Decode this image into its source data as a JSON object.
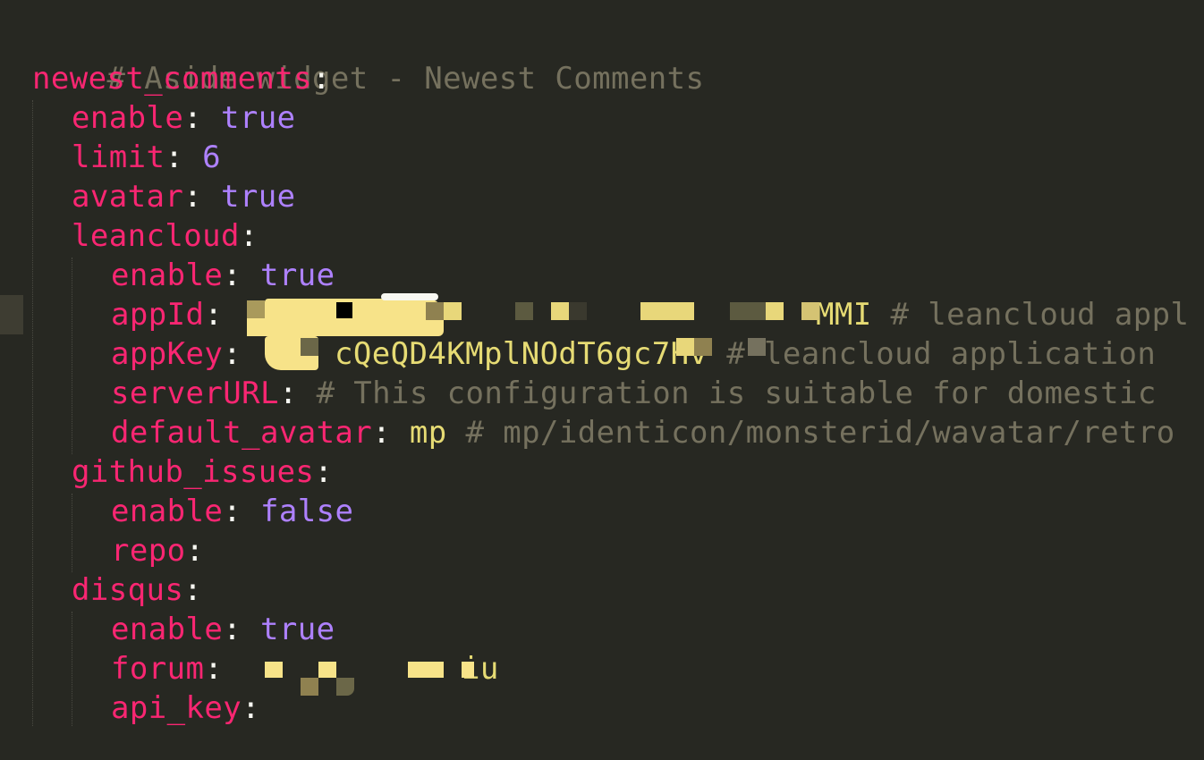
{
  "editor": {
    "language": "YAML",
    "theme_colors": {
      "background": "#272822",
      "key": "#f92672",
      "boolean_number": "#ae81ff",
      "string": "#e6db74",
      "comment": "#75715e",
      "punctuation": "#f8f8f2"
    },
    "lines": [
      {
        "comment": "# Aside widget - Newest Comments"
      },
      {
        "key": "newest_comments",
        "sep": ":"
      },
      {
        "key": "enable",
        "sep": ":",
        "value": " true"
      },
      {
        "key": "limit",
        "sep": ":",
        "value": " 6"
      },
      {
        "key": "avatar",
        "sep": ":",
        "value": " true"
      },
      {
        "key": "leancloud",
        "sep": ":"
      },
      {
        "key": "enable",
        "sep": ":",
        "value": " true"
      },
      {
        "key": "appId",
        "sep": ":",
        "value": "MMI",
        "comment": " # leancloud appl"
      },
      {
        "key": "appKey",
        "sep": ":",
        "value": "cQeQD4KMplNOdT6gc7Hv",
        "comment": " # leancloud application"
      },
      {
        "key": "serverURL",
        "sep": ":",
        "comment": " # This configuration is suitable for domestic"
      },
      {
        "key": "default_avatar",
        "sep": ":",
        "value": " mp",
        "comment": " # mp/identicon/monsterid/wavatar/retro"
      },
      {
        "key": "github_issues",
        "sep": ":"
      },
      {
        "key": "enable",
        "sep": ":",
        "value": " false"
      },
      {
        "key": "repo",
        "sep": ":"
      },
      {
        "key": "disqus",
        "sep": ":"
      },
      {
        "key": "enable",
        "sep": ":",
        "value": " true"
      },
      {
        "key": "forum",
        "sep": ":",
        "value": "iu"
      },
      {
        "key": "api_key",
        "sep": ":"
      }
    ]
  }
}
